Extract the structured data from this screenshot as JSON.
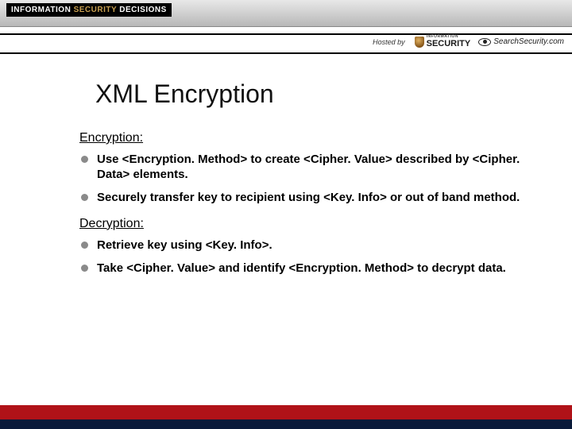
{
  "brand": {
    "line1a": "INFORMATION ",
    "line1b": "SECURITY ",
    "line1c": "DECISIONS"
  },
  "hosted": {
    "label": "Hosted by",
    "sponsor1_mini": "INFORMATION",
    "sponsor1_main": "SECURITY",
    "sponsor2": "SearchSecurity.com"
  },
  "slide": {
    "title": "XML Encryption",
    "sections": [
      {
        "label": "Encryption:",
        "bullets": [
          "Use <Encryption. Method> to create <Cipher. Value> described by <Cipher. Data> elements.",
          "Securely transfer key to recipient using <Key. Info> or out of band method."
        ]
      },
      {
        "label": "Decryption:",
        "bullets": [
          "Retrieve key using <Key. Info>.",
          "Take <Cipher. Value> and identify <Encryption. Method> to decrypt data."
        ]
      }
    ]
  }
}
